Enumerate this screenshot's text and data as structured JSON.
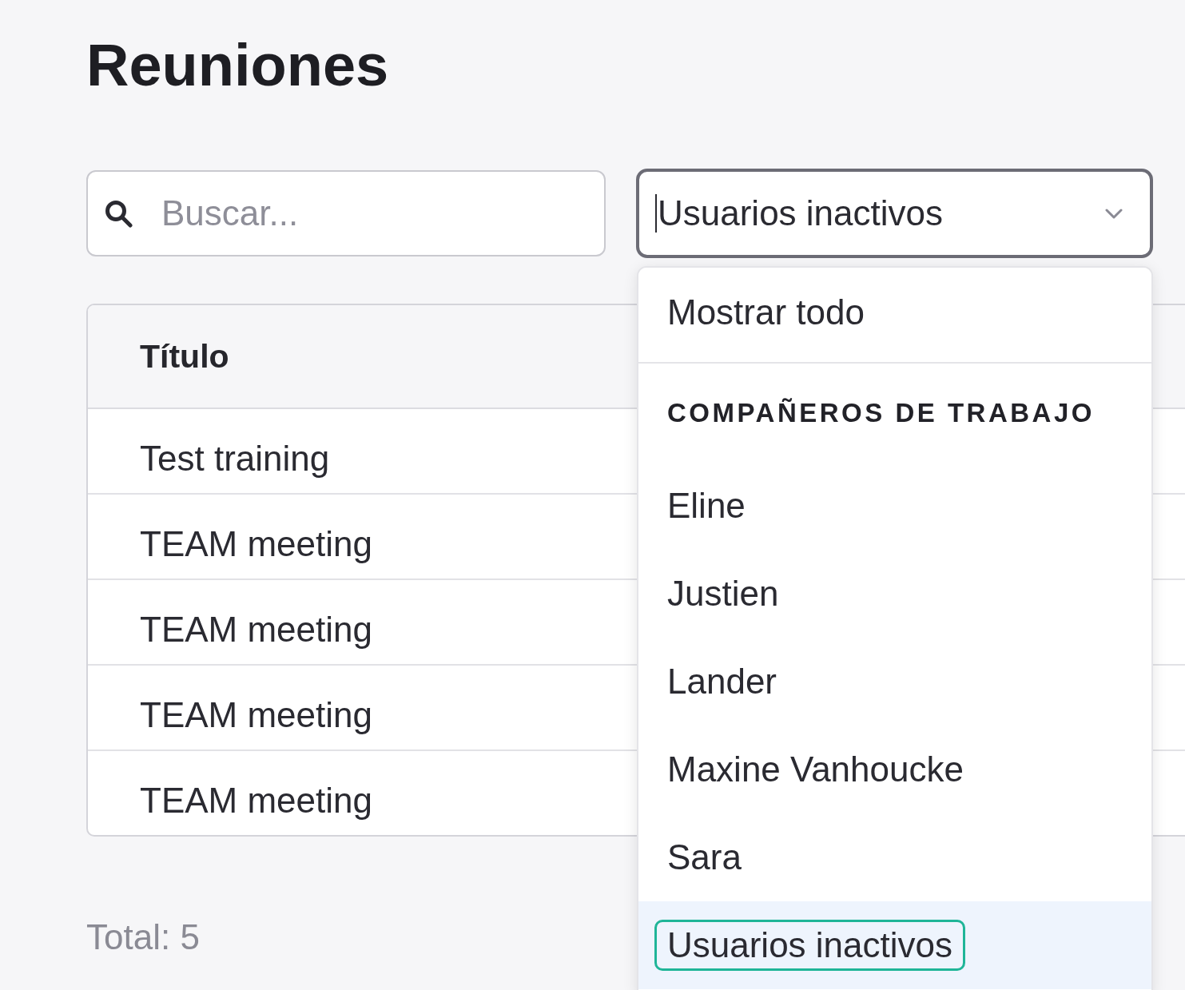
{
  "page": {
    "title": "Reuniones"
  },
  "search": {
    "placeholder": "Buscar..."
  },
  "filter": {
    "value": "Usuarios inactivos",
    "focused": true,
    "expanded": true
  },
  "filter_menu": {
    "groups": [
      {
        "options": [
          {
            "label": "Mostrar todo",
            "selected": false
          }
        ]
      },
      {
        "header": "COMPAÑEROS DE TRABAJO",
        "options": [
          {
            "label": "Eline",
            "selected": false
          },
          {
            "label": "Justien",
            "selected": false
          },
          {
            "label": "Lander",
            "selected": false
          },
          {
            "label": "Maxine Vanhoucke",
            "selected": false
          },
          {
            "label": "Sara",
            "selected": false
          },
          {
            "label": "Usuarios inactivos",
            "selected": true
          }
        ]
      }
    ]
  },
  "table": {
    "columns": [
      "Título"
    ],
    "rows": [
      [
        "Test training"
      ],
      [
        "TEAM meeting"
      ],
      [
        "TEAM meeting"
      ],
      [
        "TEAM meeting"
      ],
      [
        "TEAM meeting"
      ]
    ]
  },
  "footer": {
    "total": "Total: 5"
  }
}
